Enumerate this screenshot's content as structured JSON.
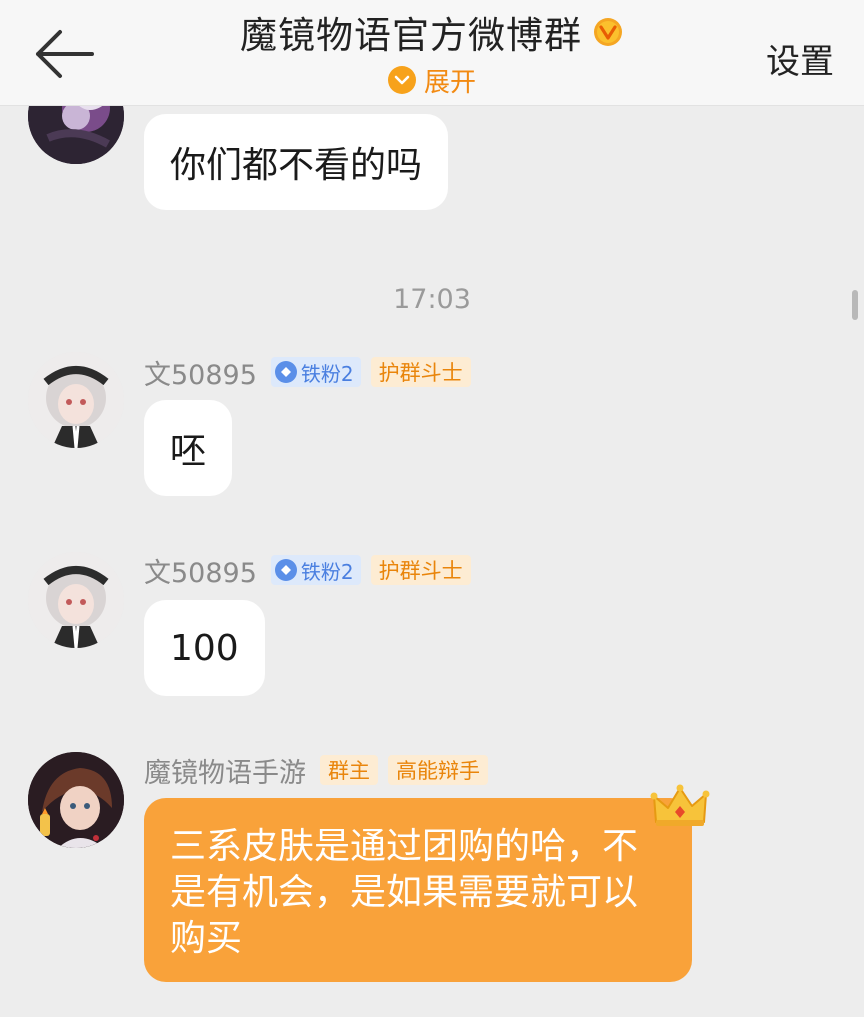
{
  "header": {
    "title": "魔镜物语官方微博群",
    "expand_label": "展开",
    "settings_label": "设置"
  },
  "messages": [
    {
      "text": "你们都不看的吗"
    },
    {
      "sender": "文50895",
      "fan_badge": "铁粉2",
      "title_badge": "护群斗士",
      "text": "呸"
    },
    {
      "sender": "文50895",
      "fan_badge": "铁粉2",
      "title_badge": "护群斗士",
      "text": "100"
    },
    {
      "sender": "魔镜物语手游",
      "role_badge": "群主",
      "title_badge": "高能辩手",
      "text": "三系皮肤是通过团购的哈，不是有机会，是如果需要就可以购买"
    }
  ],
  "timestamp": "17:03",
  "colors": {
    "accent_orange": "#f9a23a",
    "badge_blue": "#4a7fe0",
    "background": "#ededed"
  },
  "icons": [
    "back-arrow-icon",
    "verified-v-icon",
    "chevron-down-icon",
    "crown-icon"
  ]
}
